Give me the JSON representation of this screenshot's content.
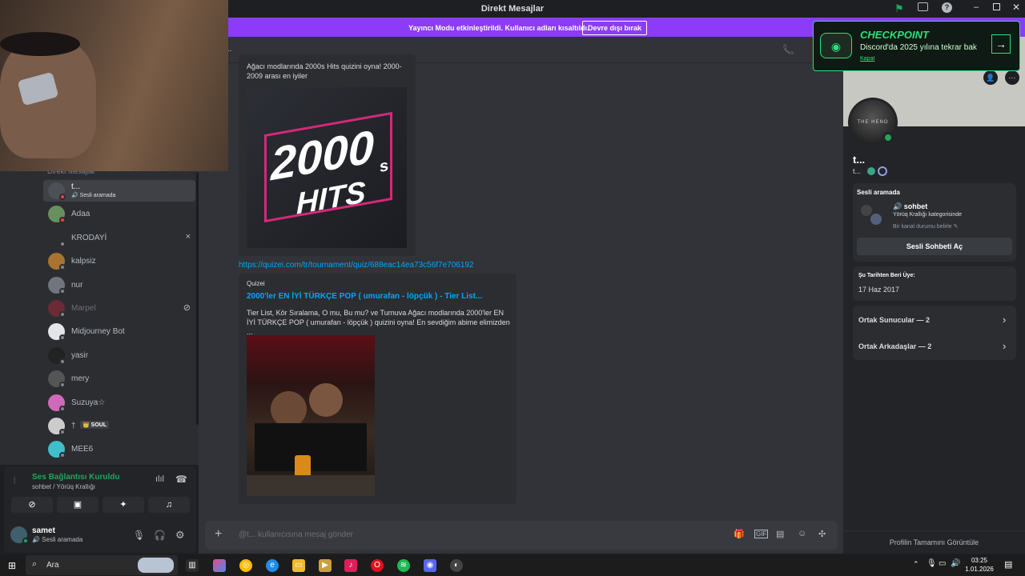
{
  "window": {
    "title": "Direkt Mesajlar"
  },
  "banner": {
    "message": "Yayıncı Modu etkinleştirildi. Kullanıcı adları kısaltıldı.",
    "button": "Devre dışı bırak"
  },
  "checkpoint": {
    "title": "CHECKPOINT",
    "subtitle": "Discord'da 2025 yılına tekrar bak",
    "link": "Kapat"
  },
  "sidebar": {
    "section_label": "Direkt Mesajlar",
    "add": "+",
    "dms": [
      {
        "name": "t...",
        "sub": "🔊 Sesli aramada",
        "color": "#4e5058",
        "status": "#f23f43",
        "active": true
      },
      {
        "name": "Adaa",
        "color": "#6a8f5e",
        "status": "#f23f43"
      },
      {
        "name": "KRODAYİ",
        "color": "#2b2d31",
        "status": "#80848e",
        "close": "×"
      },
      {
        "name": "kalpsiz",
        "color": "#a8742f",
        "status": "#80848e"
      },
      {
        "name": "nur",
        "color": "#70757e",
        "status": "#80848e"
      },
      {
        "name": "Marpel",
        "color": "#6b2a35",
        "status": "#80848e",
        "blocked": "⊘"
      },
      {
        "name": "Midjourney Bot",
        "color": "#e3e5e8",
        "status": "#80848e"
      },
      {
        "name": "yasir",
        "color": "#222",
        "status": "#80848e"
      },
      {
        "name": "mery",
        "color": "#555",
        "status": "#80848e"
      },
      {
        "name": "Suzuya☆",
        "color": "#d06ab8",
        "status": "#80848e"
      },
      {
        "name": "†",
        "badge": "👑 SOUL",
        "color": "#ccc",
        "status": "#80848e"
      },
      {
        "name": "MEE6",
        "color": "#3fbecb",
        "status": "#80848e"
      }
    ]
  },
  "voice": {
    "status": "Ses Bağlantısı Kuruldu",
    "channel": "sohbet / Yörüq Krallığı"
  },
  "user": {
    "name": "samet",
    "status": "🔊 Sesli aramada"
  },
  "chat": {
    "embed1": {
      "desc": "Ağacı modlarında 2000s Hits quizini oyna! 2000-2009 arası en iyiler",
      "img_big": "2000",
      "img_s": "s",
      "img_hits": "HITS"
    },
    "link": "https://quizei.com/tr/tournament/quiz/688eac14ea73c56f7e706192",
    "embed2": {
      "provider": "Quizei",
      "title": "2000'ler EN İYİ TÜRKÇE POP ( umurafan - löpçük ) - Tier List...",
      "desc": "Tier List, Kör Sıralama, O mu, Bu mu? ve Turnuva Ağacı modlarında 2000'ler EN İYİ TÜRKÇE POP ( umurafan - löpçük ) quizini oyna! En sevdiğim abime elimizden ..."
    },
    "input_placeholder": "@t... kullanıcısına mesaj gönder"
  },
  "profile": {
    "name": "t...",
    "tag": "t...",
    "avatar_text": "THE HENO",
    "voice_title": "Sesli aramada",
    "channel": "🔊 sohbet",
    "category": "Yörüq Krallığı kategorisinde",
    "status_hint": "Bir kanal durumu belirle ✎",
    "open_voice": "Sesli Sohbeti Aç",
    "member_since_label": "Şu Tarihten Beri Üye:",
    "member_since": "17 Haz 2017",
    "mutual_servers": "Ortak Sunucular — 2",
    "mutual_friends": "Ortak Arkadaşlar — 2",
    "full_profile": "Profilin Tamamını Görüntüle"
  },
  "taskbar": {
    "search": "Ara",
    "time": "03:25",
    "date": "1.01.2026"
  }
}
